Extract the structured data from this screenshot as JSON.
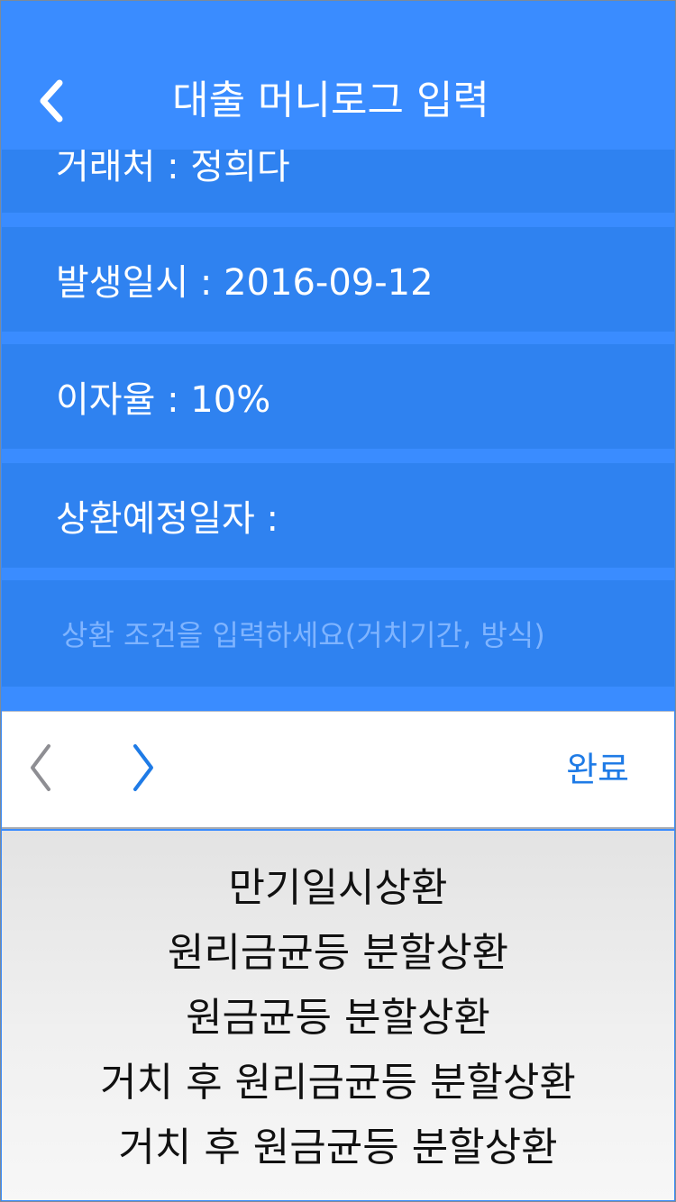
{
  "header": {
    "title": "대출 머니로그 입력",
    "back_icon": "chevron-left-icon"
  },
  "form": {
    "rows": [
      {
        "label": "거래처 : 정희다"
      },
      {
        "label": "발생일시 : 2016-09-12"
      },
      {
        "label": "이자율 : 10%"
      },
      {
        "label": "상환예정일자 :"
      }
    ],
    "condition_placeholder": "상환 조건을 입력하세요(거치기간, 방식)"
  },
  "toolbar": {
    "prev_icon": "chevron-left-icon",
    "next_icon": "chevron-right-icon",
    "done_label": "완료"
  },
  "picker": {
    "options": [
      "만기일시상환",
      "원리금균등 분할상환",
      "원금균등 분할상환",
      "거치 후 원리금균등 분할상환",
      "거치 후 원금균등 분할상환"
    ]
  },
  "colors": {
    "primary": "#3a8cff",
    "row": "#2f82f0",
    "accent": "#1f7be6"
  }
}
